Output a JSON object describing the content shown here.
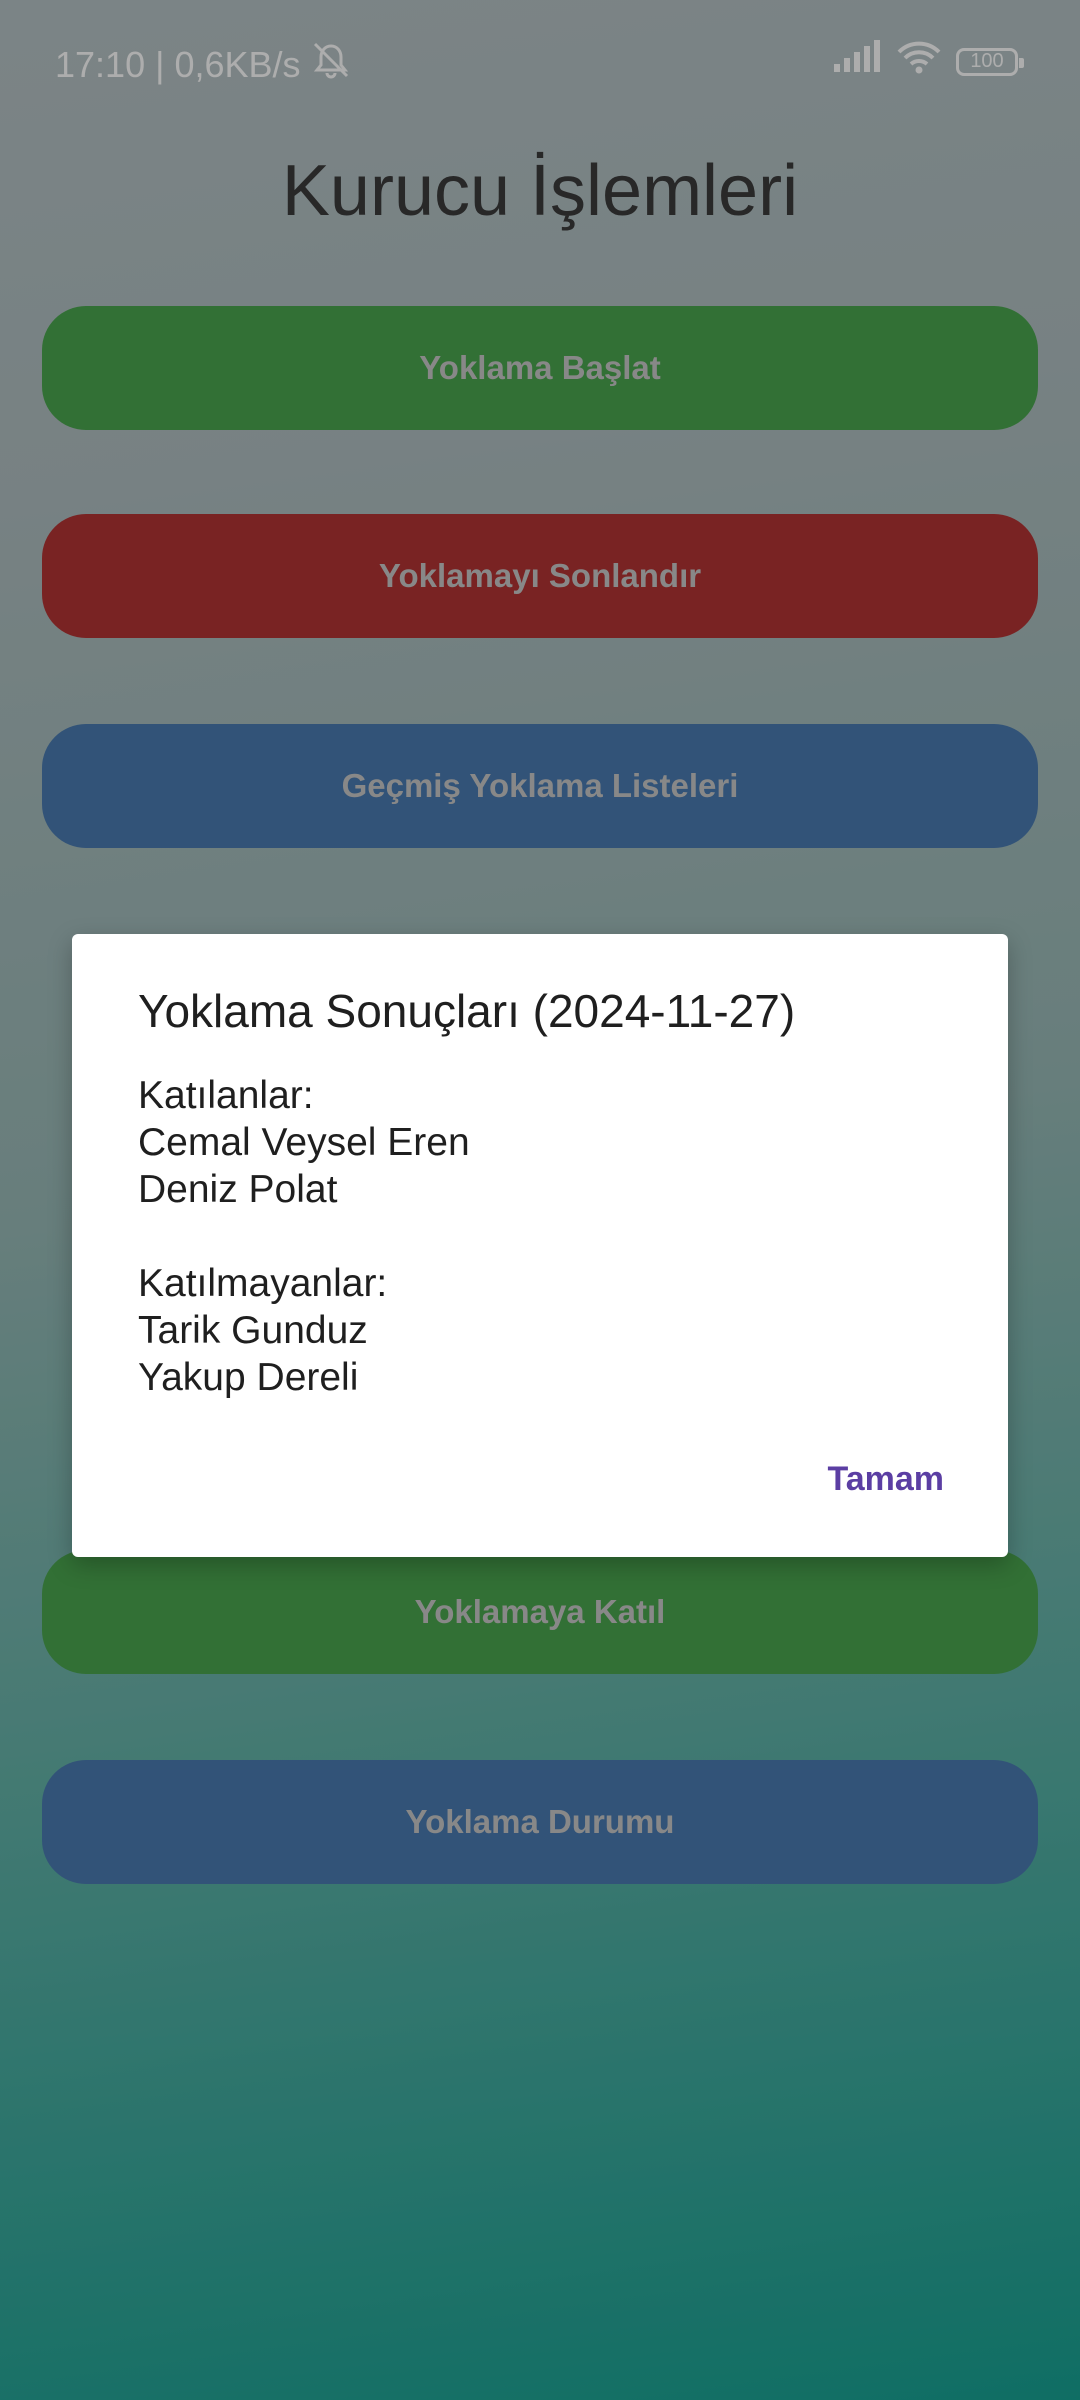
{
  "status_bar": {
    "time_and_speed": "17:10 | 0,6KB/s",
    "battery": "100"
  },
  "page": {
    "title": "Kurucu İşlemleri"
  },
  "buttons": {
    "start": "Yoklama Başlat",
    "end": "Yoklamayı Sonlandır",
    "history": "Geçmiş Yoklama Listeleri",
    "join": "Yoklamaya Katıl",
    "status": "Yoklama Durumu"
  },
  "dialog": {
    "title": "Yoklama Sonuçları (2024-11-27)",
    "attended_label": "Katılanlar:",
    "attended": [
      "Cemal Veysel Eren",
      "Deniz Polat"
    ],
    "absent_label": "Katılmayanlar:",
    "absent": [
      "Tarik Gunduz",
      "Yakup Dereli"
    ],
    "ok_label": "Tamam"
  },
  "colors": {
    "green": "#4aa64e",
    "red": "#b33434",
    "blue": "#4a7bb1",
    "accent": "#5b3ea3"
  }
}
